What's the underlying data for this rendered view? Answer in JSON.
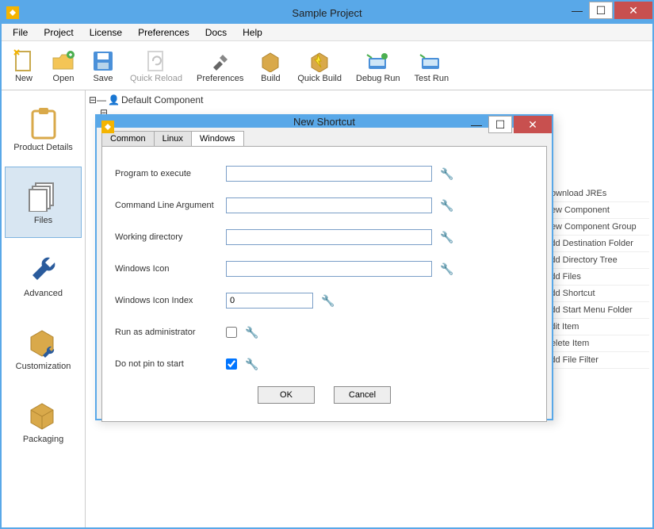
{
  "window": {
    "title": "Sample Project"
  },
  "menu": {
    "file": "File",
    "project": "Project",
    "license": "License",
    "preferences": "Preferences",
    "docs": "Docs",
    "help": "Help"
  },
  "toolbar": {
    "new": "New",
    "open": "Open",
    "save": "Save",
    "quick_reload": "Quick Reload",
    "preferences": "Preferences",
    "build": "Build",
    "quick_build": "Quick Build",
    "debug_run": "Debug Run",
    "test_run": "Test Run"
  },
  "sidebar": {
    "product_details": "Product Details",
    "files": "Files",
    "advanced": "Advanced",
    "customization": "Customization",
    "packaging": "Packaging"
  },
  "tree": {
    "root": "Default Component"
  },
  "rightmenu": {
    "items": [
      "Download JREs",
      "New Component",
      "New Component Group",
      "Add Destination Folder",
      "Add Directory Tree",
      "Add Files",
      "Add Shortcut",
      "Add Start Menu Folder",
      "Edit Item",
      "Delete Item",
      "Add File Filter"
    ]
  },
  "dialog": {
    "title": "New Shortcut",
    "tabs": {
      "common": "Common",
      "linux": "Linux",
      "windows": "Windows"
    },
    "fields": {
      "program": {
        "label": "Program to execute",
        "value": ""
      },
      "cmdline": {
        "label": "Command Line Argument",
        "value": ""
      },
      "workdir": {
        "label": "Working directory",
        "value": ""
      },
      "winicon": {
        "label": "Windows Icon",
        "value": ""
      },
      "iconidx": {
        "label": "Windows Icon Index",
        "value": "0"
      },
      "runadmin": {
        "label": "Run as administrator",
        "checked": false
      },
      "nopin": {
        "label": "Do not pin to start",
        "checked": true
      }
    },
    "buttons": {
      "ok": "OK",
      "cancel": "Cancel"
    }
  }
}
